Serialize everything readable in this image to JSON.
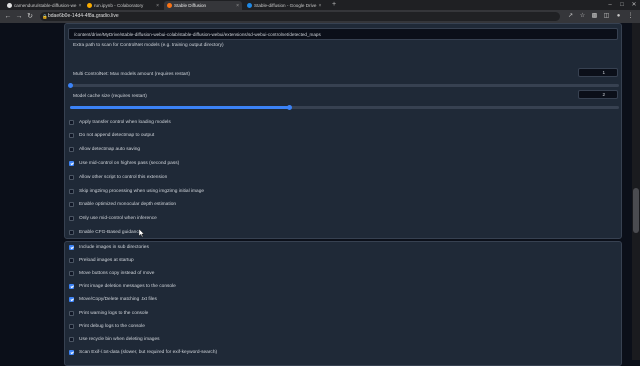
{
  "browser": {
    "tabs": [
      {
        "label": "camenduru/stable-diffusion-we",
        "color": "#e0e0e0",
        "active": false
      },
      {
        "label": "run.ipynb - Colaboratory",
        "color": "#f9ab00",
        "active": false
      },
      {
        "label": "Stable Diffusion",
        "color": "#f97316",
        "active": true
      },
      {
        "label": "Stable-diffusion - Google Drive",
        "color": "#1e88e5",
        "active": false
      }
    ],
    "new_tab": "+",
    "url": "bdae6b0e-14d4-4f8a.gradio.live",
    "back_icon": "arrow-left-icon",
    "forward_icon": "arrow-right-icon",
    "reload_icon": "reload-icon"
  },
  "settings": {
    "detected_maps_path": "/content/drive/MyDrive/stable-diffusion-webui-colab/stable-diffusion-webui/extensions/sd-webui-controlnet/detected_maps",
    "extra_path_label": "Extra path to scan for ControlNet models (e.g. training output directory)",
    "multi_controlnet_label": "Multi ControlNet: Max models amount (requires restart)",
    "multi_controlnet_value": "1",
    "multi_controlnet_fraction": 0.0,
    "model_cache_label": "Model cache size (requires restart)",
    "model_cache_value": "2",
    "model_cache_fraction": 0.4,
    "controlnet_checkboxes": [
      {
        "label": "Apply transfer control when loading models",
        "checked": false
      },
      {
        "label": "Do not append detectmap to output",
        "checked": false
      },
      {
        "label": "Allow detectmap auto saving",
        "checked": false
      },
      {
        "label": "Use mid-control on highres pass (second pass)",
        "checked": true
      },
      {
        "label": "Allow other script to control this extension",
        "checked": false
      },
      {
        "label": "Skip img2img processing when using img2img initial image",
        "checked": false
      },
      {
        "label": "Enable optimized monocular depth estimation",
        "checked": false
      },
      {
        "label": "Only use mid-control when inference",
        "checked": false
      },
      {
        "label": "Enable CFG-Based guidance",
        "checked": false
      }
    ],
    "browser_checkboxes": [
      {
        "label": "Include images in sub directories",
        "checked": true
      },
      {
        "label": "Preload images at startup",
        "checked": false
      },
      {
        "label": "Move buttons copy instead of move",
        "checked": false
      },
      {
        "label": "Print image deletion messages to the console",
        "checked": true
      },
      {
        "label": "Move/Copy/Delete matching .txt files",
        "checked": true
      },
      {
        "label": "Print warning logs to the console",
        "checked": false
      },
      {
        "label": "Print debug logs to the console",
        "checked": false
      },
      {
        "label": "Use recycle bin when deleting images",
        "checked": false
      },
      {
        "label": "Scan Exif-/.txt-data (slower, but required for exif-keyword-search)",
        "checked": true
      }
    ]
  },
  "colors": {
    "accent": "#3b82f6",
    "panel": "#1f2937",
    "background": "#0b0f19"
  }
}
